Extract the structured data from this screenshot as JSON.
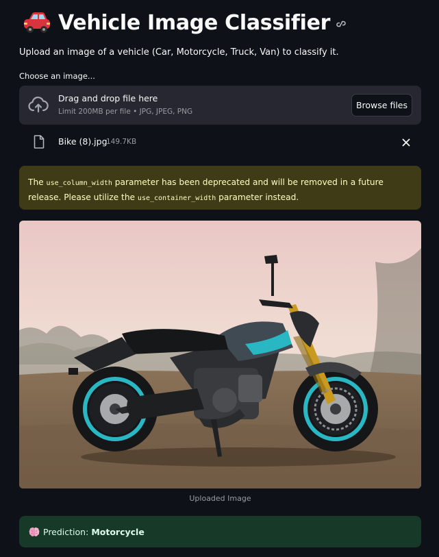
{
  "header": {
    "title": "Vehicle Image Classifier",
    "subtitle": "Upload an image of a vehicle (Car, Motorcycle, Truck, Van) to classify it."
  },
  "uploader": {
    "label": "Choose an image...",
    "drop_text": "Drag and drop file here",
    "limit_text": "Limit 200MB per file • JPG, JPEG, PNG",
    "browse_label": "Browse files"
  },
  "file": {
    "name": "Bike (8).jpg",
    "size": "149.7KB"
  },
  "warning": {
    "part1": "The ",
    "code1": "use_column_width",
    "part2": " parameter has been deprecated and will be removed in a future release. Please utilize the ",
    "code2": "use_container_width",
    "part3": " parameter instead."
  },
  "image": {
    "caption": "Uploaded Image"
  },
  "prediction": {
    "label": "Prediction:",
    "value": "Motorcycle"
  },
  "colors": {
    "background": "#0e1117",
    "dropzone": "#262730",
    "warning_bg": "#3e3b16",
    "warning_text": "#ffffc2",
    "success_bg": "#173928",
    "success_text": "#dffde9",
    "bike_accent": "#2ab7c4"
  },
  "icons": [
    "car-icon",
    "link-icon",
    "cloud-upload-icon",
    "file-icon",
    "close-icon",
    "brain-icon"
  ]
}
